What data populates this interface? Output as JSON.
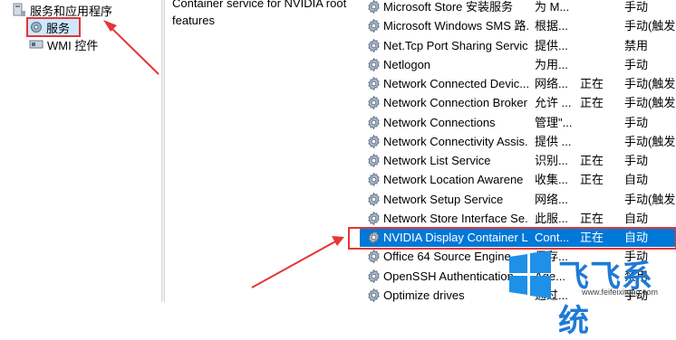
{
  "tree": {
    "root_label": "服务和应用程序",
    "services_label": "服务",
    "wmi_label": "WMI 控件"
  },
  "description": {
    "text": "Container service for NVIDIA root features"
  },
  "services": [
    {
      "name": "Microsoft Store 安装服务",
      "desc": "为 M...",
      "status": "",
      "startup": "手动"
    },
    {
      "name": "Microsoft Windows SMS 路...",
      "desc": "根据...",
      "status": "",
      "startup": "手动(触发..."
    },
    {
      "name": "Net.Tcp Port Sharing Service",
      "desc": "提供...",
      "status": "",
      "startup": "禁用"
    },
    {
      "name": "Netlogon",
      "desc": "为用...",
      "status": "",
      "startup": "手动"
    },
    {
      "name": "Network Connected Devic...",
      "desc": "网络...",
      "status": "正在",
      "startup": "手动(触发..."
    },
    {
      "name": "Network Connection Broker",
      "desc": "允许 ...",
      "status": "正在",
      "startup": "手动(触发..."
    },
    {
      "name": "Network Connections",
      "desc": "管理\"...",
      "status": "",
      "startup": "手动"
    },
    {
      "name": "Network Connectivity Assis...",
      "desc": "提供 ...",
      "status": "",
      "startup": "手动(触发..."
    },
    {
      "name": "Network List Service",
      "desc": "识别...",
      "status": "正在",
      "startup": "手动"
    },
    {
      "name": "Network Location Awarene",
      "desc": "收集...",
      "status": "正在",
      "startup": "自动"
    },
    {
      "name": "Network Setup Service",
      "desc": "网络...",
      "status": "",
      "startup": "手动(触发..."
    },
    {
      "name": "Network Store Interface Se...",
      "desc": "此服...",
      "status": "正在",
      "startup": "自动"
    },
    {
      "name": "NVIDIA Display Container LS",
      "desc": "Cont...",
      "status": "正在",
      "startup": "自动",
      "selected": true
    },
    {
      "name": "Office 64 Source Engine",
      "desc": "保存...",
      "status": "",
      "startup": "手动"
    },
    {
      "name": "OpenSSH Authentication ...",
      "desc": "Age...",
      "status": "",
      "startup": "禁用"
    },
    {
      "name": "Optimize drives",
      "desc": "通过...",
      "status": "",
      "startup": "手动"
    }
  ],
  "watermark": {
    "text": "飞飞系统",
    "url": "www.feifeixitong.com"
  },
  "colors": {
    "selection": "#0078d7",
    "tree_selection": "#cce8ff",
    "annotation_red": "#e53535",
    "watermark_blue": "#1e7bd6"
  }
}
